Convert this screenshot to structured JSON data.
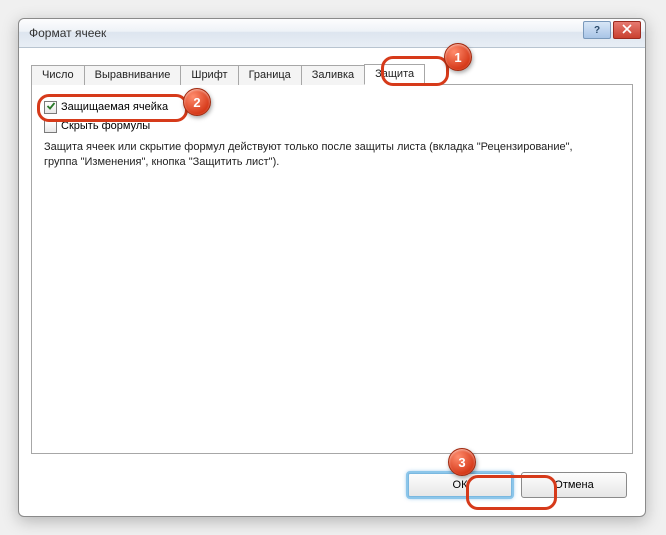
{
  "window": {
    "title": "Формат ячеек"
  },
  "tabs": {
    "items": [
      {
        "label": "Число"
      },
      {
        "label": "Выравнивание"
      },
      {
        "label": "Шрифт"
      },
      {
        "label": "Граница"
      },
      {
        "label": "Заливка"
      },
      {
        "label": "Защита"
      }
    ],
    "active_index": 5
  },
  "protection": {
    "locked": {
      "label": "Защищаемая ячейка",
      "checked": true
    },
    "hidden": {
      "label": "Скрыть формулы",
      "checked": false
    },
    "description": "Защита ячеек или скрытие формул действуют только после защиты листа (вкладка \"Рецензирование\", группа \"Изменения\", кнопка \"Защитить лист\")."
  },
  "buttons": {
    "ok": "ОК",
    "cancel": "Отмена"
  },
  "annotations": {
    "c1": "1",
    "c2": "2",
    "c3": "3"
  },
  "winbuttons": {
    "help": "?"
  }
}
